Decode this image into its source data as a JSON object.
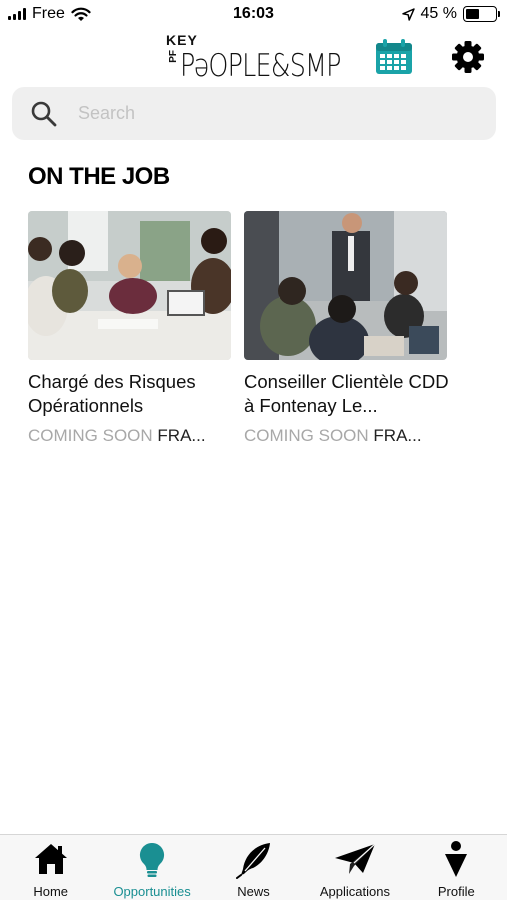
{
  "status_bar": {
    "carrier": "Free",
    "time": "16:03",
    "battery": "45 %",
    "battery_level": 0.45
  },
  "header": {
    "logo_key": "KEY",
    "logo_pf": "PF",
    "logo_main": "PəOPLE&SMP",
    "calendar_icon": "calendar-icon",
    "settings_icon": "gear-icon",
    "accent_color": "#1aa3a8"
  },
  "search": {
    "placeholder": "Search",
    "value": ""
  },
  "section": {
    "title": "ON THE JOB"
  },
  "jobs": [
    {
      "title": "Chargé des Risques Opérationnels",
      "status": "COMING SOON",
      "location": "FRA..."
    },
    {
      "title": "Conseiller Clientèle CDD à Fontenay Le...",
      "status": "COMING SOON",
      "location": "FRA..."
    }
  ],
  "tabs": [
    {
      "label": "Home",
      "icon": "home-icon"
    },
    {
      "label": "Opportunities",
      "icon": "lightbulb-icon",
      "active": true
    },
    {
      "label": "News",
      "icon": "feather-icon"
    },
    {
      "label": "Applications",
      "icon": "paper-plane-icon"
    },
    {
      "label": "Profile",
      "icon": "person-icon"
    }
  ]
}
